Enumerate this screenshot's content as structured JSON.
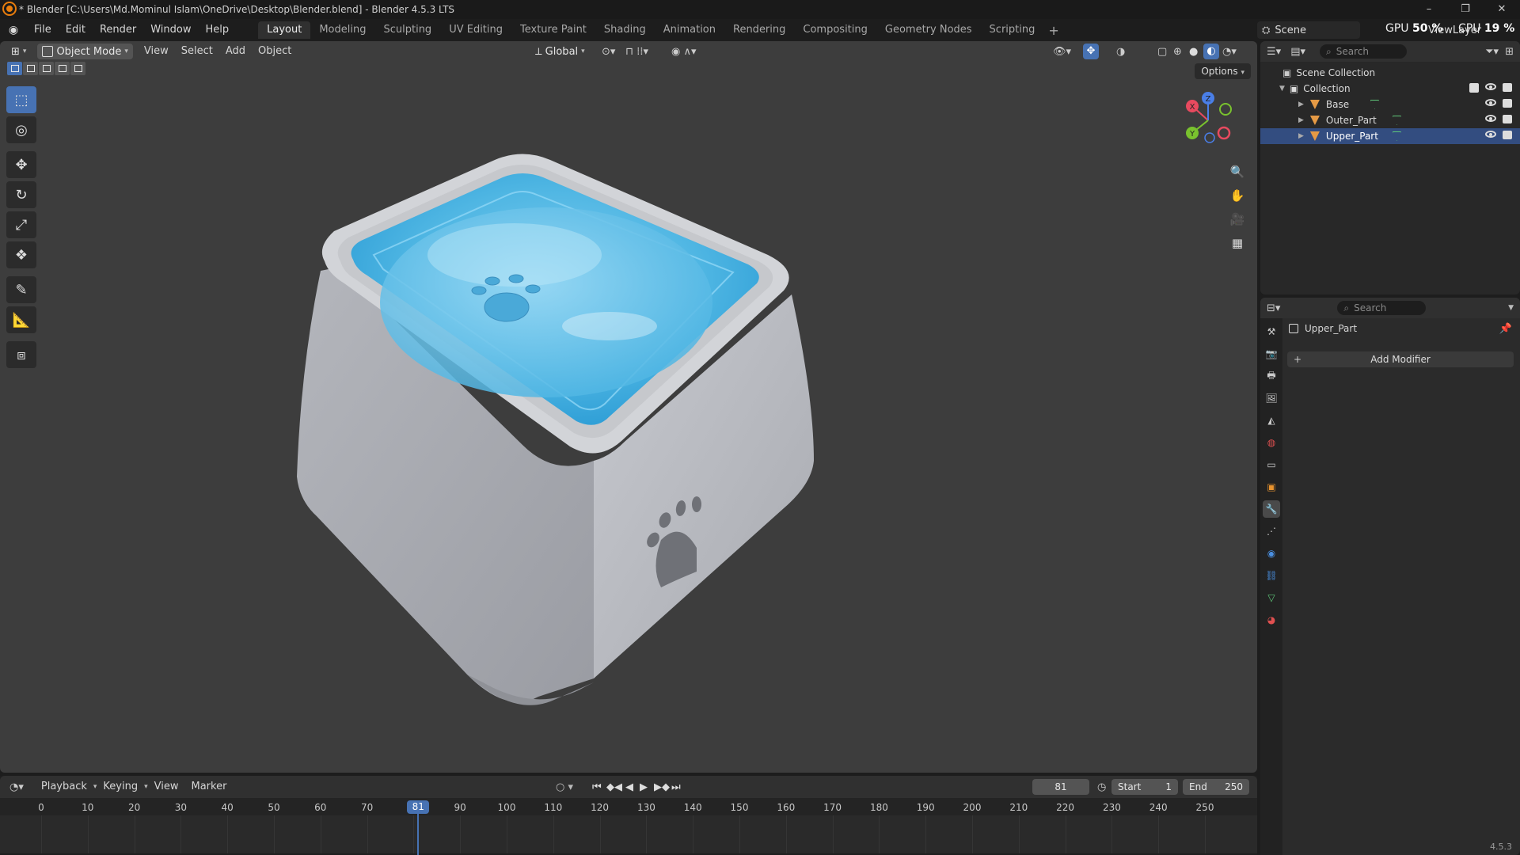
{
  "window": {
    "title": "* Blender [C:\\Users\\Md.Mominul Islam\\OneDrive\\Desktop\\Blender.blend] - Blender 4.5.3 LTS",
    "controls": [
      "–",
      "❐",
      "✕"
    ]
  },
  "menu": [
    "File",
    "Edit",
    "Render",
    "Window",
    "Help"
  ],
  "workspaces": [
    "Layout",
    "Modeling",
    "Sculpting",
    "UV Editing",
    "Texture Paint",
    "Shading",
    "Animation",
    "Rendering",
    "Compositing",
    "Geometry Nodes",
    "Scripting"
  ],
  "active_workspace": "Layout",
  "scene": "Scene",
  "view_layer": "ViewLayer",
  "stats": {
    "gpu_label": "GPU",
    "gpu_value": "50 %",
    "cpu_label": "CPU",
    "cpu_value": "19 %"
  },
  "viewport": {
    "mode": "Object Mode",
    "menus": [
      "View",
      "Select",
      "Add",
      "Object"
    ],
    "orientation": "Global",
    "options": "Options",
    "gizmo": {
      "x": "X",
      "y": "Y",
      "z": "Z"
    },
    "tools": [
      "select-box",
      "cursor",
      "move",
      "rotate",
      "scale",
      "transform",
      "annotate",
      "measure",
      "add-cube"
    ]
  },
  "timeline": {
    "menus": [
      "Playback",
      "Keying",
      "View",
      "Marker"
    ],
    "current_frame": "81",
    "start_label": "Start",
    "start": "1",
    "end_label": "End",
    "end": "250",
    "ticks": [
      "0",
      "10",
      "20",
      "30",
      "40",
      "50",
      "60",
      "70",
      "80",
      "90",
      "100",
      "110",
      "120",
      "130",
      "140",
      "150",
      "160",
      "170",
      "180",
      "190",
      "200",
      "210",
      "220",
      "230",
      "240",
      "250"
    ]
  },
  "outliner": {
    "search_placeholder": "Search",
    "scene_collection": "Scene Collection",
    "collection": "Collection",
    "objects": [
      "Base",
      "Outer_Part",
      "Upper_Part"
    ],
    "selected": "Upper_Part"
  },
  "properties": {
    "search_placeholder": "Search",
    "object_name": "Upper_Part",
    "add_modifier": "Add Modifier",
    "version": "4.5.3"
  },
  "colors": {
    "accent": "#4772b3",
    "water": "#4fb6e3",
    "bowl": "#b8bac0",
    "viewport_bg": "#3d3d3d"
  }
}
